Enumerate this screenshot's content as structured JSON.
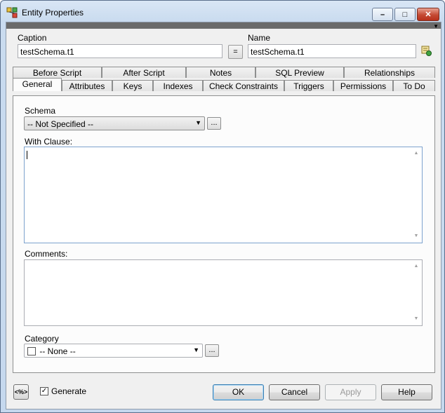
{
  "window": {
    "title": "Entity Properties",
    "minimize_glyph": "–",
    "maximize_glyph": "□",
    "close_glyph": "✕"
  },
  "header": {
    "caption_label": "Caption",
    "caption_value": "testSchema.t1",
    "equals_label": "=",
    "name_label": "Name",
    "name_value": "testSchema.t1",
    "strip_arrow": "▼"
  },
  "tabs": {
    "back_row": [
      "Before Script",
      "After Script",
      "Notes",
      "SQL Preview",
      "Relationships"
    ],
    "front_row": [
      "General",
      "Attributes",
      "Keys",
      "Indexes",
      "Check Constraints",
      "Triggers",
      "Permissions",
      "To Do"
    ],
    "active": "General"
  },
  "general": {
    "schema_label": "Schema",
    "schema_value": "-- Not Specified --",
    "with_clause_label": "With Clause:",
    "with_clause_value": "",
    "comments_label": "Comments:",
    "comments_value": "",
    "category_label": "Category",
    "category_value": "-- None --",
    "ellipsis": "...",
    "dropdown_glyph": "▼",
    "scroll_up": "▲",
    "scroll_down": "▼"
  },
  "footer": {
    "sql_button": "<%>",
    "generate_label": "Generate",
    "generate_checked": true,
    "check_glyph": "✓",
    "ok_label": "OK",
    "cancel_label": "Cancel",
    "apply_label": "Apply",
    "help_label": "Help"
  },
  "icons": [
    "entity-properties-icon",
    "name-sync-icon",
    "sql-tag-icon"
  ],
  "colors": {
    "title_bar": "#c9dbef",
    "close_button": "#c44a33",
    "focus_border": "#7da2ce"
  }
}
